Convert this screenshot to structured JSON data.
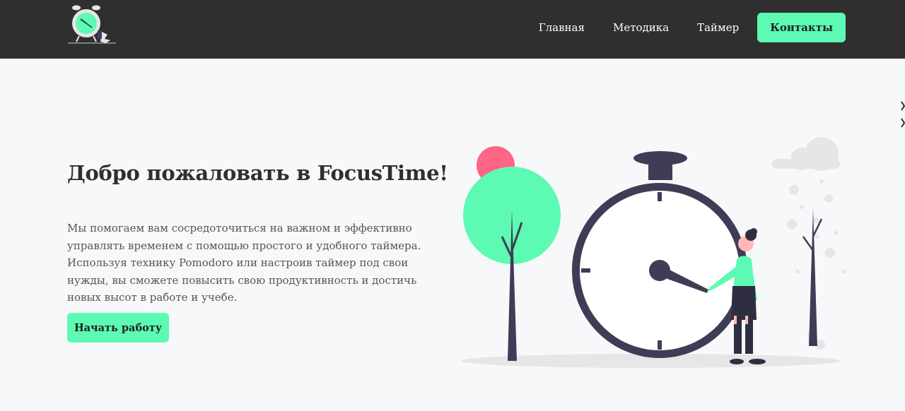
{
  "header": {
    "logo_icon": "alarm-clock-icon",
    "nav": [
      {
        "label": "Главная"
      },
      {
        "label": "Методика"
      },
      {
        "label": "Таймер"
      },
      {
        "label": "Контакты"
      }
    ]
  },
  "hero": {
    "title": "Добро пожаловать в FocusTime!",
    "description": "Мы помогаем вам сосредоточиться на важном и эффективно управлять временем с помощью простого и удобного таймера. Используя технику Pomodoro или настроив таймер под свои нужды, вы сможете повысить свою продуктивность и достичь новых высот в работе и учебе.",
    "cta_label": "Начать работу",
    "illustration": "stopwatch-illustration"
  },
  "colors": {
    "accent": "#5cfab2",
    "header_bg": "#2f2f2f",
    "page_bg": "#f7f8fa",
    "dark_ink": "#3f3d56",
    "pink": "#ff6584"
  }
}
